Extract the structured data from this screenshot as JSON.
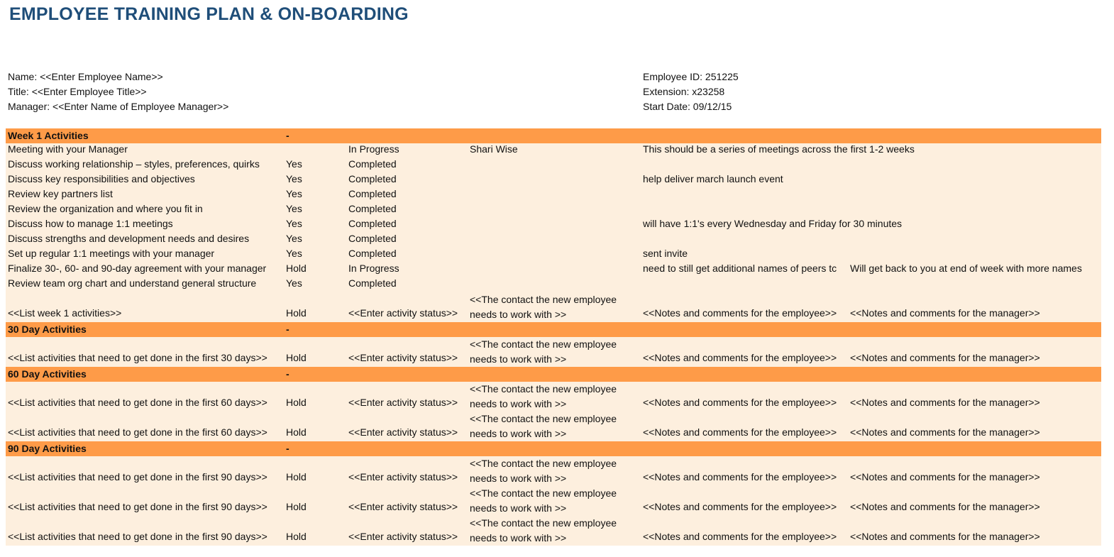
{
  "document": {
    "title": "EMPLOYEE TRAINING PLAN & ON-BOARDING"
  },
  "employee_info": {
    "name": "Name: <<Enter Employee Name>>",
    "title": "Title: <<Enter Employee Title>>",
    "manager": "Manager: <<Enter Name of Employee Manager>>",
    "employee_id": "Employee ID: 251225",
    "extension": "Extension: x23258",
    "start_date": "Start Date: 09/12/15"
  },
  "colors": {
    "title": "#1F4E79",
    "section_fill": "#FE9B48",
    "row_fill": "#FDEFDE"
  },
  "sections": [
    {
      "header": "Week 1 Activities",
      "header_flag": "-",
      "rows": [
        {
          "activity": "Meeting with your Manager",
          "flag": "",
          "status": "In Progress",
          "contact": [
            "Shari Wise"
          ],
          "employee_notes": "This should be a series of meetings across the first 1-2 weeks",
          "manager_notes": ""
        },
        {
          "activity": "Discuss working relationship – styles, preferences, quirks",
          "flag": "Yes",
          "status": "Completed",
          "contact": [],
          "employee_notes": "",
          "manager_notes": ""
        },
        {
          "activity": "Discuss key responsibilities and objectives",
          "flag": "Yes",
          "status": "Completed",
          "contact": [],
          "employee_notes": "help deliver march launch event",
          "manager_notes": ""
        },
        {
          "activity": "Review key partners list",
          "flag": "Yes",
          "status": "Completed",
          "contact": [],
          "employee_notes": "",
          "manager_notes": ""
        },
        {
          "activity": "Review the organization and where you fit in",
          "flag": "Yes",
          "status": "Completed",
          "contact": [],
          "employee_notes": "",
          "manager_notes": ""
        },
        {
          "activity": "Discuss how to manage 1:1 meetings",
          "flag": "Yes",
          "status": "Completed",
          "contact": [],
          "employee_notes": "will have 1:1's every Wednesday and Friday for 30 minutes",
          "manager_notes": ""
        },
        {
          "activity": "Discuss strengths and development needs and desires",
          "flag": "Yes",
          "status": "Completed",
          "contact": [],
          "employee_notes": "",
          "manager_notes": ""
        },
        {
          "activity": "Set up regular 1:1 meetings with your manager",
          "flag": "Yes",
          "status": "Completed",
          "contact": [],
          "employee_notes": "sent invite",
          "manager_notes": ""
        },
        {
          "activity": "Finalize 30-, 60- and 90-day agreement with your manager",
          "flag": "Hold",
          "status": "In Progress",
          "contact": [],
          "employee_notes": "need to still get additional names of peers tc",
          "manager_notes": "Will get back to you at end of week with more names"
        },
        {
          "activity": "Review team org chart and understand general structure",
          "flag": "Yes",
          "status": "Completed",
          "contact": [],
          "employee_notes": "",
          "manager_notes": ""
        },
        {
          "activity": "<<List week 1 activities>>",
          "flag": "Hold",
          "status": "<<Enter activity status>>",
          "contact": [
            "<<The contact the new employee",
            "needs to work with >>"
          ],
          "employee_notes": "<<Notes and comments for the employee>>",
          "manager_notes": "<<Notes and comments for the manager>>"
        }
      ]
    },
    {
      "header": "30 Day Activities",
      "header_flag": "-",
      "rows": [
        {
          "activity": "<<List activities that need to get done in the first 30 days>>",
          "flag": "Hold",
          "status": "<<Enter activity status>>",
          "contact": [
            "<<The contact the new employee",
            "needs to work with >>"
          ],
          "employee_notes": "<<Notes and comments for the employee>>",
          "manager_notes": "<<Notes and comments for the manager>>"
        }
      ]
    },
    {
      "header": "60 Day Activities",
      "header_flag": "-",
      "rows": [
        {
          "activity": "<<List activities that need to get done in the first 60 days>>",
          "flag": "Hold",
          "status": "<<Enter activity status>>",
          "contact": [
            "<<The contact the new employee",
            "needs to work with >>"
          ],
          "employee_notes": "<<Notes and comments for the employee>>",
          "manager_notes": "<<Notes and comments for the manager>>"
        },
        {
          "activity": "<<List activities that need to get done in the first 60 days>>",
          "flag": "Hold",
          "status": "<<Enter activity status>>",
          "contact": [
            "<<The contact the new employee",
            "needs to work with >>"
          ],
          "employee_notes": "<<Notes and comments for the employee>>",
          "manager_notes": "<<Notes and comments for the manager>>"
        }
      ]
    },
    {
      "header": "90 Day Activities",
      "header_flag": "-",
      "rows": [
        {
          "activity": "<<List activities that need to get done in the first 90 days>>",
          "flag": "Hold",
          "status": "<<Enter activity status>>",
          "contact": [
            "<<The contact the new employee",
            "needs to work with >>"
          ],
          "employee_notes": "<<Notes and comments for the employee>>",
          "manager_notes": "<<Notes and comments for the manager>>"
        },
        {
          "activity": "<<List activities that need to get done in the first 90 days>>",
          "flag": "Hold",
          "status": "<<Enter activity status>>",
          "contact": [
            "<<The contact the new employee",
            "needs to work with >>"
          ],
          "employee_notes": "<<Notes and comments for the employee>>",
          "manager_notes": "<<Notes and comments for the manager>>"
        },
        {
          "activity": "<<List activities that need to get done in the first 90 days>>",
          "flag": "Hold",
          "status": "<<Enter activity status>>",
          "contact": [
            "<<The contact the new employee",
            "needs to work with >>"
          ],
          "employee_notes": "<<Notes and comments for the employee>>",
          "manager_notes": "<<Notes and comments for the manager>>"
        }
      ]
    }
  ]
}
